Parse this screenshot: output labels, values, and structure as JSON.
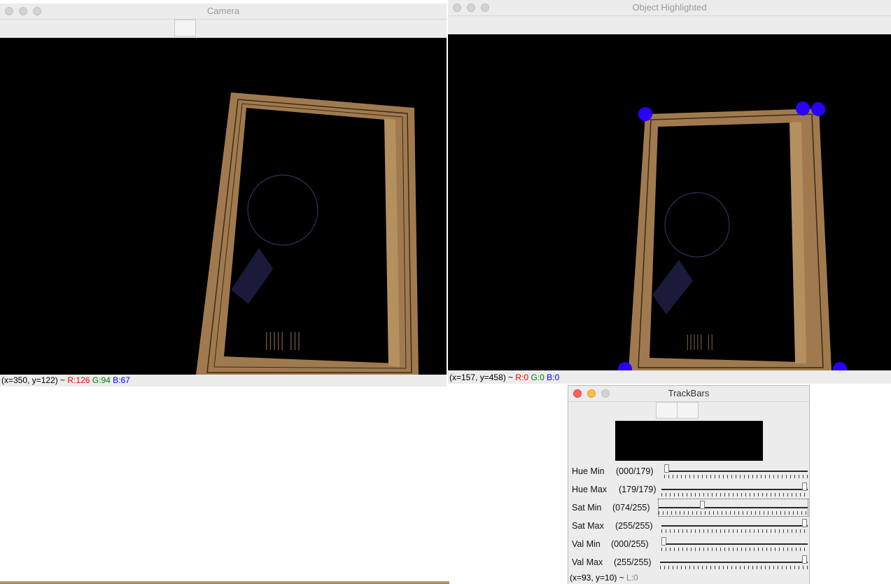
{
  "camera_window": {
    "title": "Camera",
    "status": {
      "coords": "(x=350, y=122) ~ ",
      "r": "R:126",
      "g": "G:94",
      "b": "B:67"
    }
  },
  "highlight_window": {
    "title": "Object Highlighted",
    "status": {
      "coords": "(x=157, y=458) ~ ",
      "r": "R:0",
      "g": "G:0",
      "b": "B:0"
    }
  },
  "trackbars_window": {
    "title": "TrackBars",
    "status": {
      "coords": "(x=93, y=10) ~ ",
      "l": "L:0"
    },
    "sliders": [
      {
        "name": "Hue Min",
        "display": "(000/179)",
        "value": 0,
        "max": 179
      },
      {
        "name": "Hue Max",
        "display": "(179/179)",
        "value": 179,
        "max": 179
      },
      {
        "name": "Sat Min",
        "display": "(074/255)",
        "value": 74,
        "max": 255
      },
      {
        "name": "Sat Max",
        "display": "(255/255)",
        "value": 255,
        "max": 255
      },
      {
        "name": "Val Min",
        "display": "(000/255)",
        "value": 0,
        "max": 255
      },
      {
        "name": "Val Max",
        "display": "(255/255)",
        "value": 255,
        "max": 255
      }
    ]
  },
  "colors": {
    "frame_cardboard": "#a07a4e",
    "marker": "#2a00ff"
  }
}
